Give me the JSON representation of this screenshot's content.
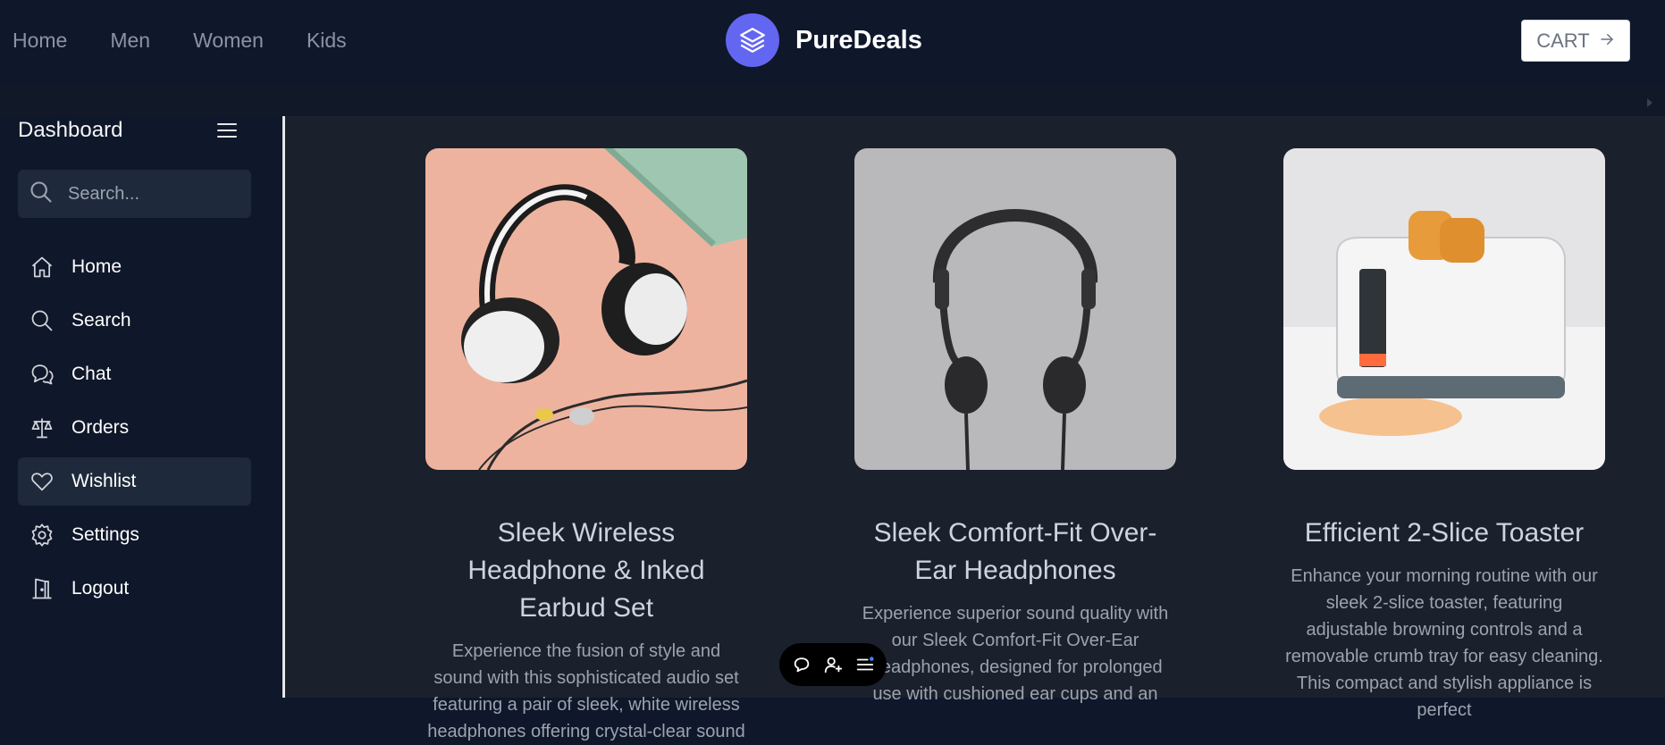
{
  "nav": {
    "links": [
      "Home",
      "Men",
      "Women",
      "Kids"
    ]
  },
  "brand": {
    "name": "PureDeals",
    "logo_icon": "layers-icon",
    "logo_color": "#6366f1"
  },
  "cart": {
    "label": "CART",
    "icon": "arrow-right-icon"
  },
  "sidebar": {
    "title": "Dashboard",
    "menu_icon": "hamburger-menu-icon",
    "search_placeholder": "Search...",
    "items": [
      {
        "label": "Home",
        "icon": "home-icon"
      },
      {
        "label": "Search",
        "icon": "search-icon"
      },
      {
        "label": "Chat",
        "icon": "chat-icon"
      },
      {
        "label": "Orders",
        "icon": "scale-icon"
      },
      {
        "label": "Wishlist",
        "icon": "heart-icon",
        "active": true
      },
      {
        "label": "Settings",
        "icon": "gear-icon"
      },
      {
        "label": "Logout",
        "icon": "door-icon"
      }
    ]
  },
  "products": [
    {
      "title": "Sleek Wireless Headphone & Inked Earbud Set",
      "description": "Experience the fusion of style and sound with this sophisticated audio set featuring a pair of sleek, white wireless headphones offering crystal-clear sound",
      "image": "white-headphones-earbuds-on-peach-background"
    },
    {
      "title": "Sleek Comfort-Fit Over-Ear Headphones",
      "description": "Experience superior sound quality with our Sleek Comfort-Fit Over-Ear Headphones, designed for prolonged use with cushioned ear cups and an",
      "image": "black-headphones-on-grey-background"
    },
    {
      "title": "Efficient 2-Slice Toaster",
      "description": "Enhance your morning routine with our sleek 2-slice toaster, featuring adjustable browning controls and a removable crumb tray for easy cleaning. This compact and stylish appliance is perfect",
      "image": "white-toaster-with-toast"
    }
  ],
  "float_toolbar": {
    "icons": [
      "chat-bubble-icon",
      "add-user-icon",
      "list-notification-icon"
    ]
  }
}
